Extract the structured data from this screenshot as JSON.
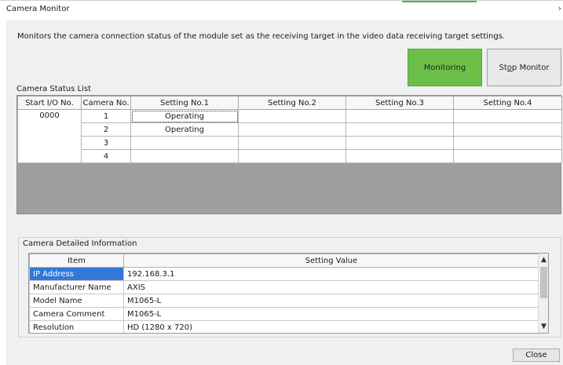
{
  "window": {
    "title": "Camera Monitor",
    "close_glyph": "›"
  },
  "description": "Monitors the camera connection status of the module set as the receiving target in the video data receiving target settings.",
  "buttons": {
    "monitoring": "Monitoring",
    "stop_pre": "St",
    "stop_mnemonic": "o",
    "stop_post": "p Monitor",
    "close": "Close"
  },
  "status": {
    "label": "Camera Status List",
    "columns": [
      "Start I/O No.",
      "Camera No.",
      "Setting No.1",
      "Setting No.2",
      "Setting No.3",
      "Setting No.4"
    ],
    "start_io": "0000",
    "rows": [
      {
        "camera": "1",
        "s1": "Operating",
        "s2": "",
        "s3": "",
        "s4": ""
      },
      {
        "camera": "2",
        "s1": "Operating",
        "s2": "",
        "s3": "",
        "s4": ""
      },
      {
        "camera": "3",
        "s1": "",
        "s2": "",
        "s3": "",
        "s4": ""
      },
      {
        "camera": "4",
        "s1": "",
        "s2": "",
        "s3": "",
        "s4": ""
      }
    ]
  },
  "detail": {
    "label": "Camera Detailed Information",
    "columns": [
      "Item",
      "Setting Value"
    ],
    "rows": [
      {
        "item": "IP Address",
        "value": "192.168.3.1"
      },
      {
        "item": "Manufacturer Name",
        "value": "AXIS"
      },
      {
        "item": "Model Name",
        "value": "M1065-L"
      },
      {
        "item": "Camera Comment",
        "value": "M1065-L"
      },
      {
        "item": "Resolution",
        "value": "HD (1280 x 720)"
      }
    ]
  },
  "colors": {
    "monitoring_active": "#6cc04a",
    "selection": "#3378d7",
    "empty_area": "#9f9f9f"
  }
}
